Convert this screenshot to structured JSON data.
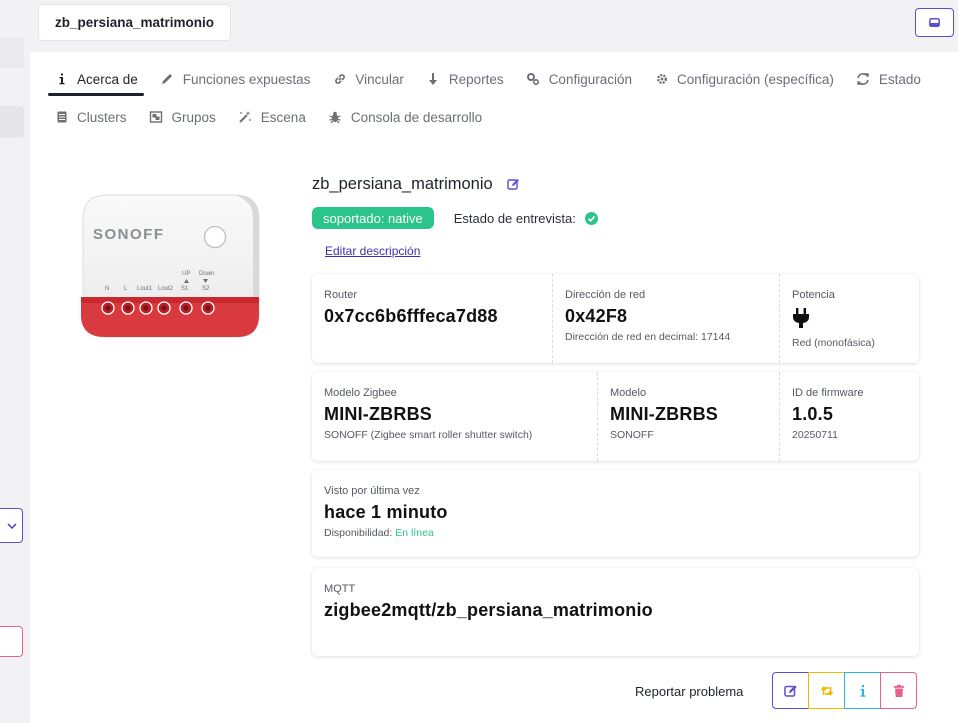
{
  "topbar": {
    "device_tab": "zb_persiana_matrimonio",
    "inbox_icon": "inbox-icon"
  },
  "tabs": {
    "row1": [
      {
        "label": "Acerca de",
        "icon": "info-icon",
        "active": true
      },
      {
        "label": "Funciones expuestas",
        "icon": "pencil-icon"
      },
      {
        "label": "Vincular",
        "icon": "link-icon"
      },
      {
        "label": "Reportes",
        "icon": "download-arrow-icon"
      },
      {
        "label": "Configuración",
        "icon": "cogs-icon"
      },
      {
        "label": "Configuración (específica)",
        "icon": "gear-icon"
      },
      {
        "label": "Estado",
        "icon": "refresh-icon"
      }
    ],
    "row2": [
      {
        "label": "Clusters",
        "icon": "list-icon"
      },
      {
        "label": "Grupos",
        "icon": "object-group-icon"
      },
      {
        "label": "Escena",
        "icon": "magic-wand-icon"
      },
      {
        "label": "Consola de desarrollo",
        "icon": "bug-icon"
      }
    ]
  },
  "device": {
    "name": "zb_persiana_matrimonio",
    "supported_badge": "soportado: native",
    "interview_label": "Estado de entrevista:",
    "edit_description": "Editar descripción",
    "image_brand": "SONOFF",
    "terminal_labels": [
      "N",
      "L",
      "Lout1",
      "Lout2",
      "S1",
      "S2"
    ],
    "terminal_up": "UP",
    "terminal_down": "Down"
  },
  "cards": {
    "network": {
      "router_label": "Router",
      "router_value": "0x7cc6b6fffeca7d88",
      "address_label": "Dirección de red",
      "address_value": "0x42F8",
      "address_decimal": "Dirección de red en decimal: 17144",
      "power_label": "Potencia",
      "power_sub": "Red (monofásica)"
    },
    "model": {
      "zigbee_label": "Modelo Zigbee",
      "zigbee_value": "MINI-ZBRBS",
      "zigbee_sub": "SONOFF (Zigbee smart roller shutter switch)",
      "model_label": "Modelo",
      "model_value": "MINI-ZBRBS",
      "model_sub": "SONOFF",
      "fw_label": "ID de firmware",
      "fw_value": "1.0.5",
      "fw_sub": "20250711"
    },
    "seen": {
      "label": "Visto por última vez",
      "value": "hace 1 minuto",
      "availability_label": "Disponibilidad:",
      "availability_value": "En línea"
    },
    "mqtt": {
      "label": "MQTT",
      "value": "zigbee2mqtt/zb_persiana_matrimonio"
    }
  },
  "actions": {
    "report_label": "Reportar problema"
  },
  "colors": {
    "accent": "#5a4fd3",
    "success": "#2bc48a",
    "warning": "#f2b705",
    "info": "#2ab3e0",
    "danger": "#e8618c"
  }
}
